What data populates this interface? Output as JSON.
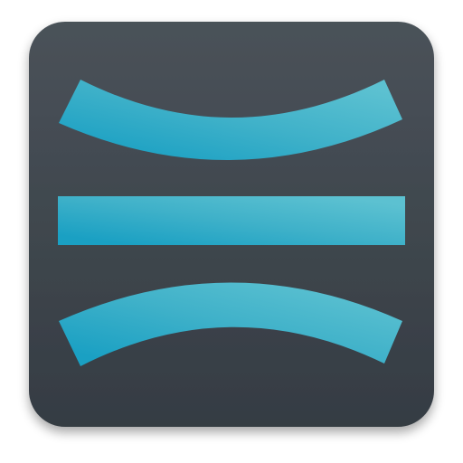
{
  "icon": {
    "name": "stacked-curved-bars-app-icon",
    "colors": {
      "tile_top": "#4a5259",
      "tile_bottom": "#353c43",
      "bar_light": "#5cc1d1",
      "bar_mid": "#3fb1c9",
      "bar_dark": "#1aa0c3",
      "shadow": "#000000"
    }
  }
}
